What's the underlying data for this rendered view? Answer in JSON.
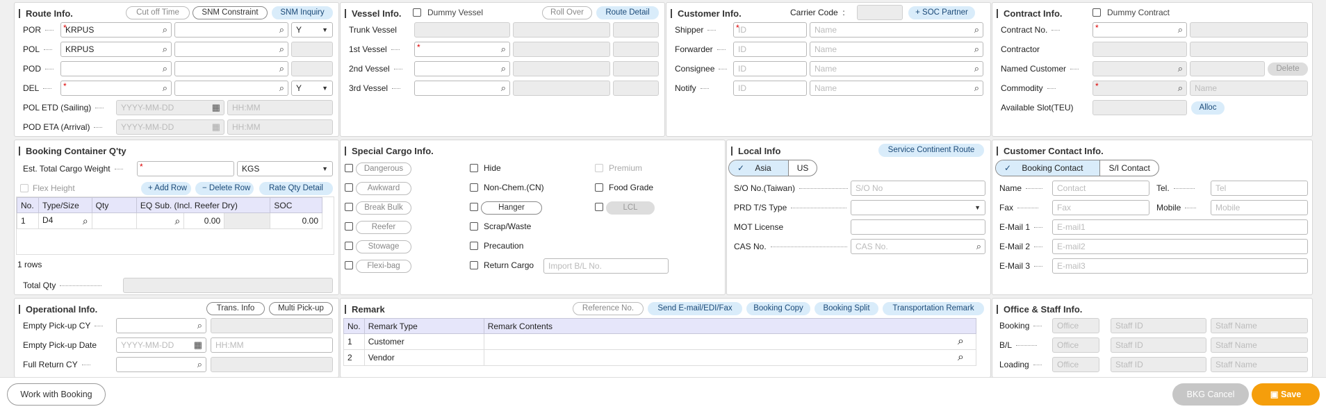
{
  "route": {
    "title": "Route Info.",
    "cutoff": "Cut off Time",
    "snm_c": "SNM Constraint",
    "snm_i": "SNM Inquiry",
    "por": "POR",
    "pol": "POL",
    "pod": "POD",
    "del": "DEL",
    "por_val": "KRPUS",
    "pol_val": "KRPUS",
    "por_y": "Y",
    "del_y": "Y",
    "etd": "POL ETD (Sailing)",
    "eta": "POD ETA (Arrival)",
    "date_ph": "YYYY-MM-DD",
    "time_ph": "HH:MM"
  },
  "vessel": {
    "title": "Vessel Info.",
    "dummy": "Dummy Vessel",
    "roll": "Roll Over",
    "detail": "Route Detail",
    "trunk": "Trunk Vessel",
    "v1": "1st Vessel",
    "v2": "2nd Vessel",
    "v3": "3rd Vessel"
  },
  "customer": {
    "title": "Customer Info.",
    "carrier": "Carrier Code",
    "colon": ":",
    "soc": "+ SOC Partner",
    "shipper": "Shipper",
    "forwarder": "Forwarder",
    "consignee": "Consignee",
    "notify": "Notify",
    "id_ph": "ID",
    "name_ph": "Name"
  },
  "contract": {
    "title": "Contract Info.",
    "dummy": "Dummy Contract",
    "no": "Contract No.",
    "contractor": "Contractor",
    "named": "Named Customer",
    "delete": "Delete",
    "commodity": "Commodity",
    "name_ph": "Name",
    "slot": "Available Slot(TEU)",
    "alloc": "Alloc"
  },
  "bcq": {
    "title": "Booking Container Q'ty",
    "weight": "Est. Total Cargo Weight",
    "unit": "KGS",
    "flex": "Flex Height",
    "add": "+ Add Row",
    "del": "− Delete Row",
    "rate": "Rate Qty Detail",
    "headers": [
      "No.",
      "Type/Size",
      "Qty",
      "EQ Sub. (Incl. Reefer Dry)",
      "SOC"
    ],
    "row": {
      "no": "1",
      "type": "D4",
      "v1": "0.00",
      "v2": "0.00"
    },
    "rows": "1 rows",
    "total": "Total Qty"
  },
  "special": {
    "title": "Special Cargo Info.",
    "c1": [
      "Dangerous",
      "Awkward",
      "Break Bulk",
      "Reefer",
      "Stowage",
      "Flexi-bag"
    ],
    "c2": [
      "Hide",
      "Non-Chem.(CN)",
      "Hanger",
      "Scrap/Waste",
      "Precaution",
      "Return Cargo"
    ],
    "premium": "Premium",
    "food": "Food Grade",
    "lcl": "LCL",
    "import_ph": "Import B/L No."
  },
  "local": {
    "title": "Local Info",
    "svc": "Service Continent Route",
    "asia": "Asia",
    "us": "US",
    "so": "S/O No.(Taiwan)",
    "so_ph": "S/O No",
    "prd": "PRD T/S Type",
    "mot": "MOT License",
    "cas": "CAS No.",
    "cas_ph": "CAS No."
  },
  "contact": {
    "title": "Customer Contact Info.",
    "booking": "Booking Contact",
    "si": "S/I Contact",
    "name": "Name",
    "tel": "Tel.",
    "fax": "Fax",
    "mobile": "Mobile",
    "e1": "E-Mail 1",
    "e2": "E-Mail 2",
    "e3": "E-Mail 3",
    "contact_ph": "Contact",
    "tel_ph": "Tel",
    "fax_ph": "Fax",
    "mobile_ph": "Mobile",
    "e1_ph": "E-mail1",
    "e2_ph": "E-mail2",
    "e3_ph": "E-mail3"
  },
  "oper": {
    "title": "Operational Info.",
    "trans": "Trans. Info",
    "multi": "Multi Pick-up",
    "empty_cy": "Empty Pick-up CY",
    "empty_date": "Empty Pick-up Date",
    "full_cy": "Full Return CY",
    "date_ph": "YYYY-MM-DD",
    "time_ph": "HH:MM"
  },
  "remark": {
    "title": "Remark",
    "ref": "Reference No.",
    "send": "Send E-mail/EDI/Fax",
    "copy": "Booking Copy",
    "split": "Booking Split",
    "trans": "Transportation Remark",
    "headers": [
      "No.",
      "Remark Type",
      "Remark Contents"
    ],
    "rows": [
      {
        "no": "1",
        "type": "Customer"
      },
      {
        "no": "2",
        "type": "Vendor"
      }
    ]
  },
  "office": {
    "title": "Office & Staff Info.",
    "booking": "Booking",
    "bl": "B/L",
    "loading": "Loading",
    "office_ph": "Office",
    "staff_id_ph": "Staff ID",
    "staff_name_ph": "Staff Name"
  },
  "footer": {
    "work": "Work with Booking",
    "cancel": "BKG Cancel",
    "save": "Save"
  }
}
